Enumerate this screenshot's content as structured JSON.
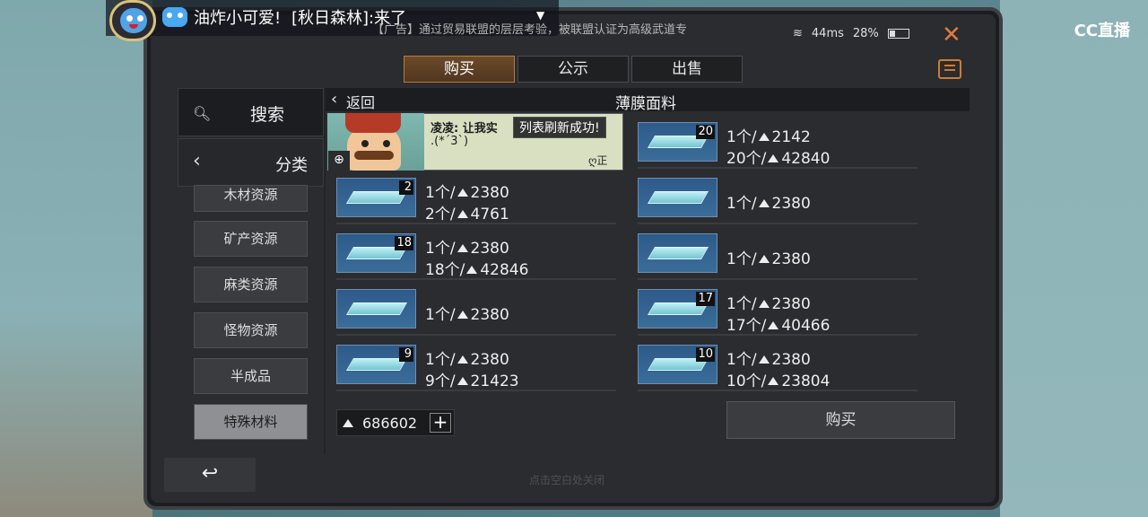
{
  "stream": {
    "chat_user": "油炸小可爱!",
    "chat_message": "[秋日森林]:来了",
    "platform_logo": "CC直播"
  },
  "status": {
    "announcement": "【广告】通过贸易联盟的层层考验，被联盟认证为高级武道专",
    "ping": "44ms",
    "battery": "28%"
  },
  "tabs": [
    {
      "label": "购买",
      "active": true
    },
    {
      "label": "公示",
      "active": false
    },
    {
      "label": "出售",
      "active": false
    }
  ],
  "nav": {
    "search_label": "搜索",
    "category_label": "分类",
    "subcategories": [
      {
        "label": "木材资源",
        "active": false
      },
      {
        "label": "矿产资源",
        "active": false
      },
      {
        "label": "麻类资源",
        "active": false
      },
      {
        "label": "怪物资源",
        "active": false
      },
      {
        "label": "半成品",
        "active": false
      },
      {
        "label": "特殊材料",
        "active": true
      }
    ]
  },
  "list": {
    "back_label": "返回",
    "title": "薄膜面料"
  },
  "npc": {
    "line1": "凌凌: 让我实",
    "line2": ".(*´3`)",
    "signature": "ღ正"
  },
  "toast": "列表刷新成功!",
  "items": [
    {
      "qty": "20",
      "unit_price": "1个/",
      "price": "2142",
      "total_qty": "20个/",
      "total": "42840"
    },
    {
      "qty": "2",
      "unit_price": "1个/",
      "price": "2380",
      "total_qty": "2个/",
      "total": "4761"
    },
    {
      "qty": "",
      "unit_price": "1个/",
      "price": "2380",
      "total_qty": "",
      "total": ""
    },
    {
      "qty": "18",
      "unit_price": "1个/",
      "price": "2380",
      "total_qty": "18个/",
      "total": "42846"
    },
    {
      "qty": "",
      "unit_price": "1个/",
      "price": "2380",
      "total_qty": "",
      "total": ""
    },
    {
      "qty": "",
      "unit_price": "1个/",
      "price": "2380",
      "total_qty": "",
      "total": ""
    },
    {
      "qty": "17",
      "unit_price": "1个/",
      "price": "2380",
      "total_qty": "17个/",
      "total": "40466"
    },
    {
      "qty": "9",
      "unit_price": "1个/",
      "price": "2380",
      "total_qty": "9个/",
      "total": "21423"
    },
    {
      "qty": "10",
      "unit_price": "1个/",
      "price": "2380",
      "total_qty": "10个/",
      "total": "23804"
    }
  ],
  "footer": {
    "balance": "686602",
    "add_label": "+",
    "buy_label": "购买",
    "back_icon": "↩",
    "close_hint": "点击空白处关闭"
  },
  "colors": {
    "accent": "#b97a3a",
    "close": "#e07a3a",
    "item_thumb": "#2e5a8a"
  }
}
